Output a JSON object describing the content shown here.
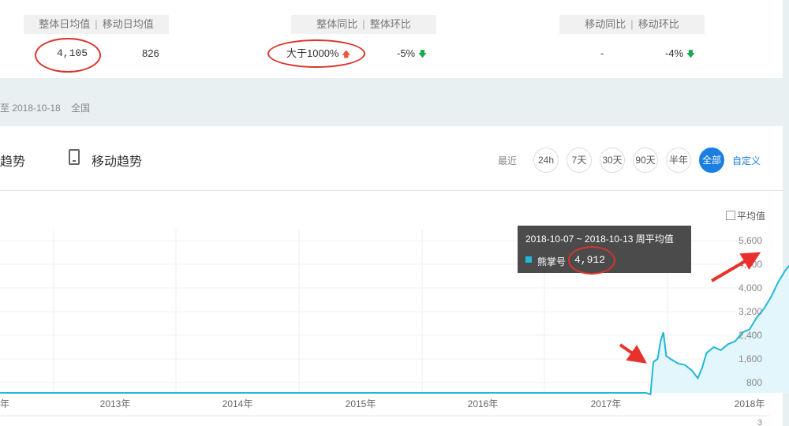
{
  "stats": {
    "group1": {
      "label_a": "整体日均值",
      "label_b": "移动日均值",
      "value_a": "4,105",
      "value_b": "826"
    },
    "group2": {
      "label_a": "整体同比",
      "label_b": "整体环比",
      "value_a": "大于1000%",
      "value_b": "-5%"
    },
    "group3": {
      "label_a": "移动同比",
      "label_b": "移动环比",
      "value_a": "-",
      "value_b": "-4%"
    },
    "separator": "|"
  },
  "date_range": {
    "text": "至 2018-10-18",
    "region": "全国"
  },
  "tabs": {
    "overall": "趋势",
    "mobile": "移动趋势"
  },
  "range": {
    "label": "最近",
    "options": [
      "24h",
      "7天",
      "30天",
      "90天",
      "半年",
      "全部"
    ],
    "active": "全部",
    "custom": "自定义"
  },
  "average_toggle": {
    "label": "平均值",
    "checked": false
  },
  "tooltip": {
    "title": "2018-10-07 ~ 2018-10-13 周平均值",
    "series": "熊掌号",
    "value": "4,912"
  },
  "colors": {
    "series": "#1fb8d8",
    "area": "#e3f6fb",
    "accent": "#1a7fe0",
    "annotation": "#d9342b"
  },
  "chart_data": {
    "type": "area",
    "x_ticks": [
      "年",
      "2013年",
      "2014年",
      "2015年",
      "2016年",
      "2017年",
      "2018年"
    ],
    "y_ticks": [
      "800",
      "1,600",
      "2,400",
      "3,200",
      "4,000",
      "4,800",
      "5,600"
    ],
    "ylim": [
      400,
      5800
    ],
    "series": [
      {
        "name": "熊掌号",
        "points": [
          [
            2012.2,
            0
          ],
          [
            2013,
            0
          ],
          [
            2014,
            0
          ],
          [
            2015,
            0
          ],
          [
            2016,
            0
          ],
          [
            2017,
            0
          ],
          [
            2017.28,
            0
          ],
          [
            2017.31,
            400
          ],
          [
            2017.33,
            1500
          ],
          [
            2017.36,
            1600
          ],
          [
            2017.38,
            2200
          ],
          [
            2017.4,
            2500
          ],
          [
            2017.42,
            1700
          ],
          [
            2017.45,
            1600
          ],
          [
            2017.5,
            1450
          ],
          [
            2017.55,
            1400
          ],
          [
            2017.6,
            1200
          ],
          [
            2017.64,
            950
          ],
          [
            2017.67,
            1300
          ],
          [
            2017.7,
            1800
          ],
          [
            2017.75,
            2000
          ],
          [
            2017.8,
            1900
          ],
          [
            2017.85,
            2100
          ],
          [
            2017.9,
            2200
          ],
          [
            2017.95,
            2500
          ],
          [
            2018.0,
            2600
          ],
          [
            2018.05,
            3000
          ],
          [
            2018.1,
            3300
          ],
          [
            2018.15,
            3700
          ],
          [
            2018.2,
            4200
          ],
          [
            2018.25,
            4600
          ],
          [
            2018.3,
            4900
          ],
          [
            2018.32,
            4300
          ],
          [
            2018.33,
            3200
          ],
          [
            2018.34,
            2900
          ],
          [
            2018.36,
            5500
          ],
          [
            2018.38,
            5600
          ]
        ]
      }
    ],
    "grid": true,
    "legend": "none"
  }
}
